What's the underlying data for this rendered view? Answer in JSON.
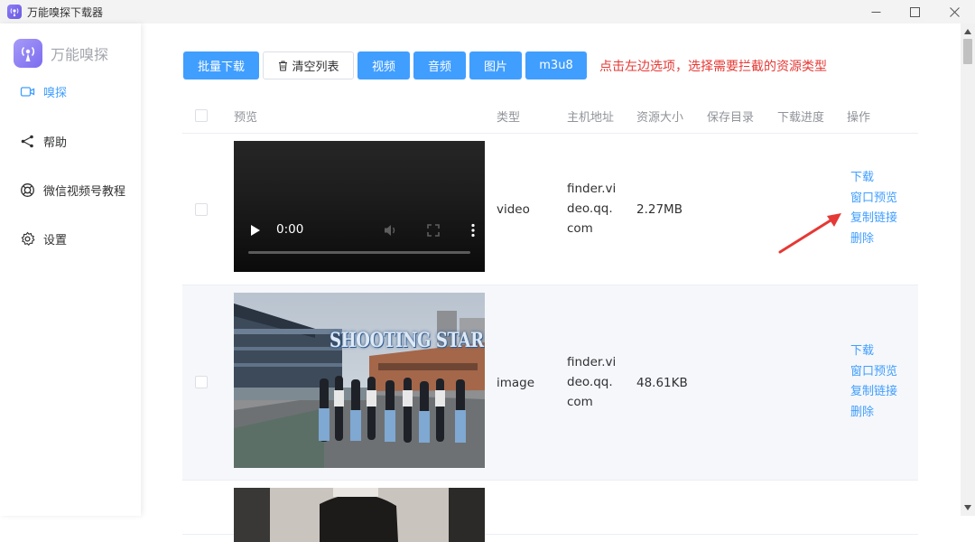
{
  "window": {
    "title": "万能嗅探下载器",
    "icons": [
      "app-icon",
      "minimize-icon",
      "maximize-icon",
      "close-icon"
    ]
  },
  "sidebar": {
    "brand": "万能嗅探",
    "items": [
      {
        "label": "嗅探",
        "icon": "video-camera-icon",
        "active": true
      },
      {
        "label": "帮助",
        "icon": "share-icon",
        "active": false
      },
      {
        "label": "微信视频号教程",
        "icon": "lifebuoy-icon",
        "active": false
      },
      {
        "label": "设置",
        "icon": "gear-icon",
        "active": false
      }
    ]
  },
  "toolbar": {
    "batch_download": "批量下载",
    "clear_list": "清空列表",
    "video": "视频",
    "audio": "音频",
    "image": "图片",
    "m3u8": "m3u8",
    "hint": "点击左边选项，选择需要拦截的资源类型"
  },
  "table": {
    "headers": {
      "preview": "预览",
      "type": "类型",
      "host": "主机地址",
      "size": "资源大小",
      "save_dir": "保存目录",
      "progress": "下载进度",
      "actions": "操作"
    },
    "rows": [
      {
        "type": "video",
        "host_lines": [
          "finder.vi",
          "deo.qq.",
          "com"
        ],
        "size": "2.27MB",
        "video_time": "0:00",
        "actions": [
          "下载",
          "窗口预览",
          "复制链接",
          "删除"
        ]
      },
      {
        "type": "image",
        "host_lines": [
          "finder.vi",
          "deo.qq.",
          "com"
        ],
        "size": "48.61KB",
        "thumb_text": "SHOOTING STAR",
        "actions": [
          "下载",
          "窗口预览",
          "复制链接",
          "删除"
        ]
      }
    ]
  },
  "colors": {
    "accent": "#409eff",
    "hint": "#e53935",
    "brand_gradient": "#7b6cf0"
  }
}
